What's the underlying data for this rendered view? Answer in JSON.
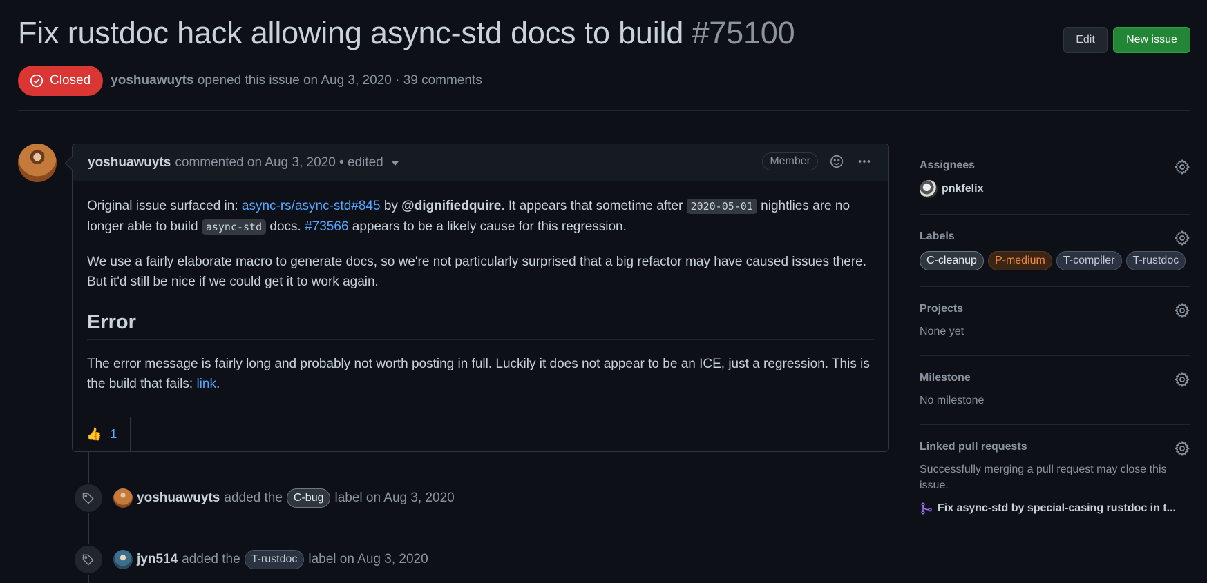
{
  "issue": {
    "title": "Fix rustdoc hack allowing async-std docs to build",
    "number": "#75100",
    "state": "Closed",
    "author": "yoshuawuyts",
    "meta_suffix": "opened this issue on Aug 3, 2020 · 39 comments"
  },
  "actions": {
    "edit_label": "Edit",
    "new_issue_label": "New issue"
  },
  "comment": {
    "author": "yoshuawuyts",
    "meta": "commented on Aug 3, 2020 • edited",
    "role_badge": "Member",
    "p1_text1": "Original issue surfaced in: ",
    "p1_link1": "async-rs/async-std#845",
    "p1_text2": " by ",
    "p1_mention": "@dignifiedquire",
    "p1_text3": ". It appears that sometime after ",
    "p1_code1": "2020-05-01",
    "p1_text4": " nightlies are no longer able to build ",
    "p1_code2": "async-std",
    "p1_text5": " docs. ",
    "p1_link2": "#73566",
    "p1_text6": " appears to be a likely cause for this regression.",
    "p2": "We use a fairly elaborate macro to generate docs, so we're not particularly surprised that a big refactor may have caused issues there. But it'd still be nice if we could get it to work again.",
    "heading": "Error",
    "p3_text1": "The error message is fairly long and probably not worth posting in full. Luckily it does not appear to be an ICE, just a regression. This is the build that fails: ",
    "p3_link": "link",
    "p3_text2": ".",
    "reaction_emoji": "👍",
    "reaction_count": "1"
  },
  "events": [
    {
      "actor": "yoshuawuyts",
      "action": "added the",
      "label": "C-bug",
      "label_bg": "#30363d",
      "label_fg": "#c9d1d9",
      "suffix": "label on Aug 3, 2020"
    },
    {
      "actor": "jyn514",
      "action": "added the",
      "label": "T-rustdoc",
      "label_bg": "#2d3748",
      "label_fg": "#c9d1d9",
      "suffix": "label on Aug 3, 2020"
    }
  ],
  "sidebar": {
    "assignees_title": "Assignees",
    "assignee": "pnkfelix",
    "labels_title": "Labels",
    "labels": [
      {
        "name": "C-cleanup",
        "bg": "#30363d",
        "fg": "#e6edf3",
        "border": "#6e7681"
      },
      {
        "name": "P-medium",
        "bg": "#3d2516",
        "fg": "#f0883e",
        "border": "#5c3a22"
      },
      {
        "name": "T-compiler",
        "bg": "#2b3340",
        "fg": "#c0cad8",
        "border": "#4b5668"
      },
      {
        "name": "T-rustdoc",
        "bg": "#2b3340",
        "fg": "#c0cad8",
        "border": "#4b5668"
      }
    ],
    "projects_title": "Projects",
    "projects_value": "None yet",
    "milestone_title": "Milestone",
    "milestone_value": "No milestone",
    "linked_title": "Linked pull requests",
    "linked_desc": "Successfully merging a pull request may close this issue.",
    "linked_pr": "Fix async-std by special-casing rustdoc in t..."
  },
  "colors": {
    "background": "#0d1117",
    "accent_link": "#58a6ff",
    "closed_red": "#da3633",
    "new_issue_green": "#238636",
    "pr_merged_purple": "#a371f7"
  }
}
